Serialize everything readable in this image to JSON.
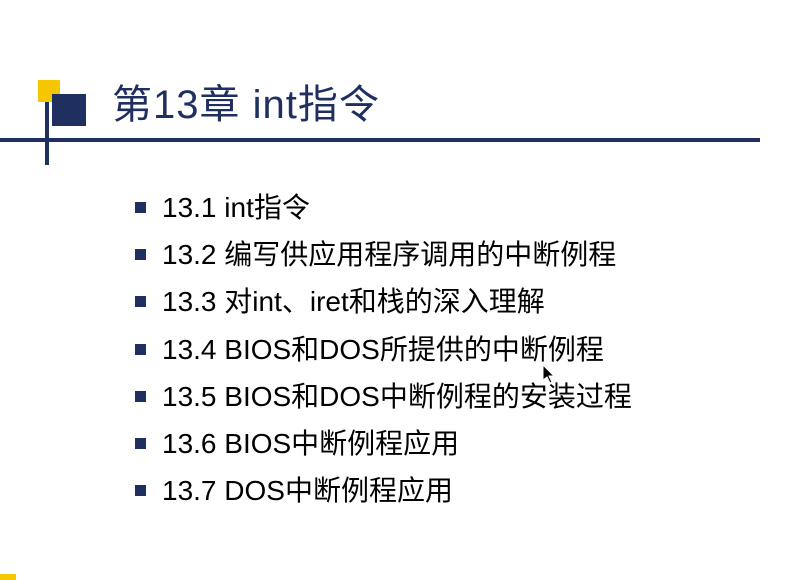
{
  "slide": {
    "title": "第13章 int指令",
    "items": [
      "13.1 int指令",
      "13.2 编写供应用程序调用的中断例程",
      "13.3 对int、iret和栈的深入理解",
      "13.4 BIOS和DOS所提供的中断例程",
      "13.5 BIOS和DOS中断例程的安装过程",
      "13.6 BIOS中断例程应用",
      "13.7 DOS中断例程应用"
    ]
  }
}
